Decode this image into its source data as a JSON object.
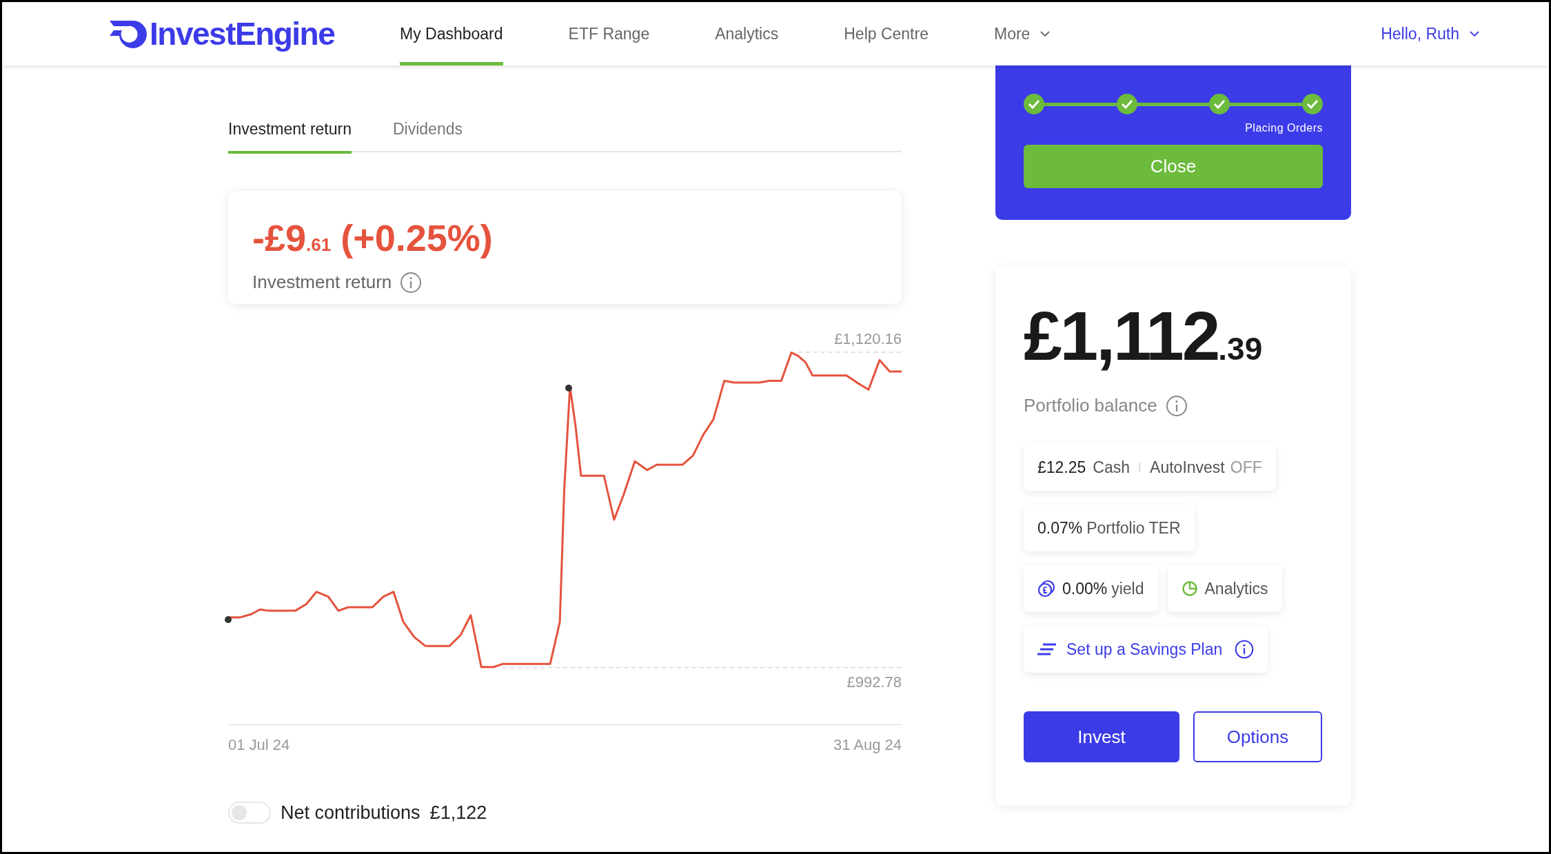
{
  "nav": {
    "logo": "InvestEngine",
    "items": [
      {
        "label": "My Dashboard",
        "selected": true,
        "dropdown": false
      },
      {
        "label": "ETF Range",
        "selected": false,
        "dropdown": false
      },
      {
        "label": "Analytics",
        "selected": false,
        "dropdown": false
      },
      {
        "label": "Help Centre",
        "selected": false,
        "dropdown": false
      },
      {
        "label": "More",
        "selected": false,
        "dropdown": true
      }
    ],
    "user_menu": "Hello, Ruth"
  },
  "tabs": [
    {
      "label": "Investment return",
      "selected": true
    },
    {
      "label": "Dividends",
      "selected": false
    }
  ],
  "return_card": {
    "amount_main": "-£9",
    "amount_decimals": ".61",
    "percent": "(+0.25%)",
    "label": "Investment return"
  },
  "chart": {
    "max_label": "£1,120.16",
    "min_label": "£992.78",
    "start_date": "01 Jul 24",
    "end_date": "31 Aug 24"
  },
  "net_contributions": {
    "label": "Net contributions",
    "value": "£1,122",
    "on": false
  },
  "getting_started": {
    "steps": [
      {
        "done": true
      },
      {
        "done": true
      },
      {
        "done": true
      },
      {
        "done": true
      }
    ],
    "step_label": "Placing Orders",
    "button": "Close"
  },
  "portfolio": {
    "balance_main": "£1,112",
    "balance_decimals": ".39",
    "label": "Portfolio balance",
    "chip_rows": [
      [
        {
          "kind": "cash",
          "amount": "£12.25",
          "label": "Cash",
          "autoinvest_label": "AutoInvest",
          "autoinvest_state": "OFF"
        }
      ],
      [
        {
          "kind": "ter",
          "value": "0.07%",
          "label": "Portfolio TER"
        }
      ],
      [
        {
          "kind": "yield",
          "value": "0.00%",
          "label": "yield"
        },
        {
          "kind": "analytics",
          "label": "Analytics"
        }
      ],
      [
        {
          "kind": "savings",
          "label": "Set up a Savings Plan"
        }
      ]
    ],
    "buttons": [
      {
        "label": "Invest",
        "kind": "primary"
      },
      {
        "label": "Options",
        "kind": "secondary"
      }
    ]
  }
}
